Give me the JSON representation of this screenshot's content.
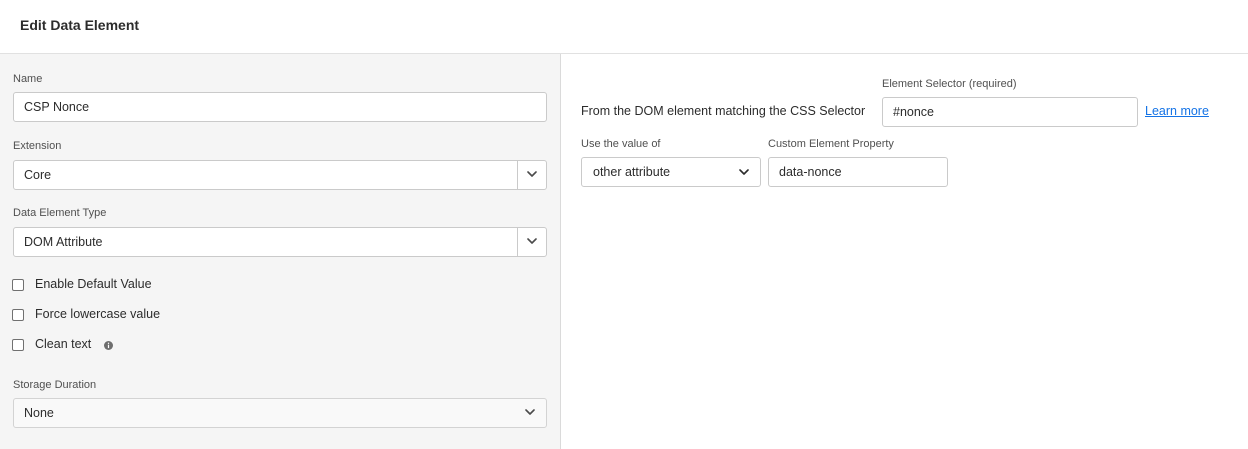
{
  "header": {
    "title": "Edit Data Element"
  },
  "left": {
    "name": {
      "label": "Name",
      "value": "CSP Nonce"
    },
    "extension": {
      "label": "Extension",
      "value": "Core"
    },
    "type": {
      "label": "Data Element Type",
      "value": "DOM Attribute"
    },
    "checkboxes": {
      "default_value": "Enable Default Value",
      "lowercase": "Force lowercase value",
      "clean_text": "Clean text"
    },
    "storage": {
      "label": "Storage Duration",
      "value": "None"
    }
  },
  "right": {
    "from_text": "From the DOM element matching the CSS Selector",
    "selector": {
      "label": "Element Selector (required)",
      "value": "#nonce"
    },
    "learn_more": "Learn more",
    "use_value": {
      "label": "Use the value of",
      "value": "other attribute"
    },
    "custom_property": {
      "label": "Custom Element Property",
      "value": "data-nonce"
    }
  },
  "icons": {
    "chevron": "chevron-down-icon",
    "info": "info-icon"
  },
  "colors": {
    "link": "#1473e6",
    "panel_bg": "#f5f5f5"
  }
}
